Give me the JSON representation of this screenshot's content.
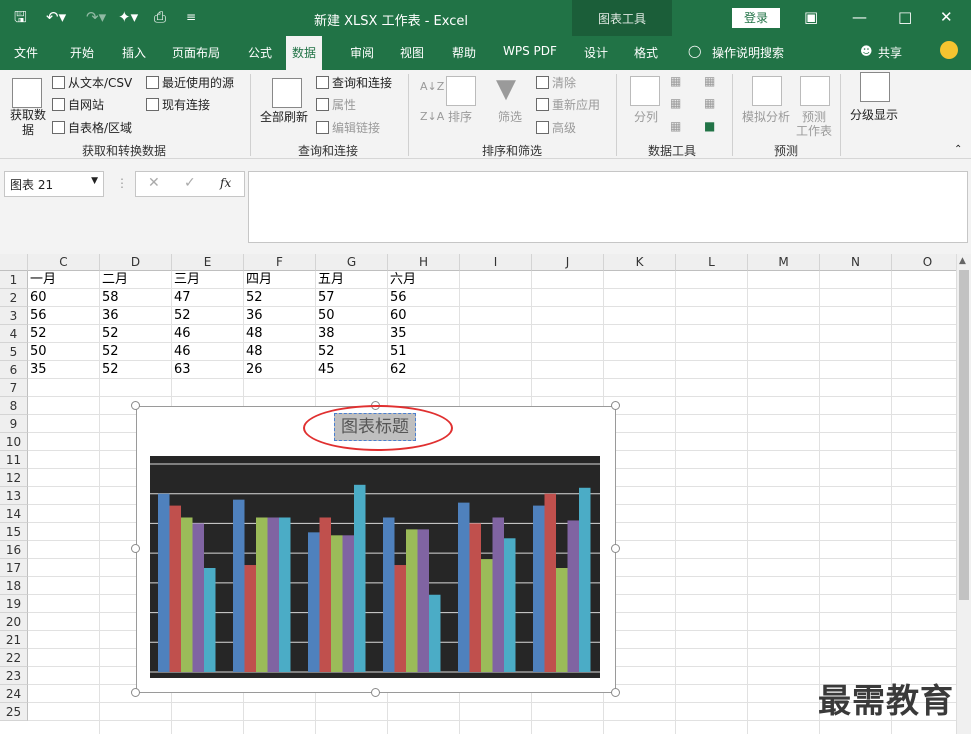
{
  "window": {
    "title": "新建 XLSX 工作表 - Excel",
    "context_group": "图表工具",
    "login": "登录"
  },
  "tabs": [
    "文件",
    "开始",
    "插入",
    "页面布局",
    "公式",
    "数据",
    "审阅",
    "视图",
    "帮助",
    "WPS PDF",
    "设计",
    "格式"
  ],
  "active_tab": "数据",
  "tell_me": "操作说明搜索",
  "share": "共享",
  "ribbon": {
    "get": {
      "big": "获取数据",
      "from_text": "从文本/CSV",
      "from_web": "自网站",
      "from_table": "自表格/区域",
      "recent": "最近使用的源",
      "existing": "现有连接",
      "label": "获取和转换数据"
    },
    "query": {
      "refresh": "全部刷新",
      "queries": "查询和连接",
      "props": "属性",
      "edit": "编辑链接",
      "label": "查询和连接"
    },
    "sort": {
      "sort": "排序",
      "filter": "筛选",
      "clear": "清除",
      "reapply": "重新应用",
      "advanced": "高级",
      "label": "排序和筛选"
    },
    "tools": {
      "split": "分列",
      "label": "数据工具"
    },
    "forecast": {
      "whatif": "模拟分析",
      "sheet": "预测",
      "sheet2": "工作表",
      "label": "预测"
    },
    "outline": {
      "label": "分级显示"
    }
  },
  "formula_bar": {
    "name_box": "图表 21",
    "fx": "fx"
  },
  "columns": [
    "C",
    "D",
    "E",
    "F",
    "G",
    "H",
    "I",
    "J",
    "K",
    "L",
    "M",
    "N",
    "O"
  ],
  "rows": [
    "1",
    "2",
    "3",
    "4",
    "5",
    "6",
    "7",
    "8",
    "9",
    "10",
    "11",
    "12",
    "13",
    "14",
    "15",
    "16",
    "17",
    "18",
    "19",
    "20",
    "21",
    "22",
    "23",
    "24",
    "25"
  ],
  "table": {
    "headers": [
      "一月",
      "二月",
      "三月",
      "四月",
      "五月",
      "六月"
    ],
    "rows": [
      [
        "60",
        "58",
        "47",
        "52",
        "57",
        "56"
      ],
      [
        "56",
        "36",
        "52",
        "36",
        "50",
        "60"
      ],
      [
        "52",
        "52",
        "46",
        "48",
        "38",
        "35"
      ],
      [
        "50",
        "52",
        "46",
        "48",
        "52",
        "51"
      ],
      [
        "35",
        "52",
        "63",
        "26",
        "45",
        "62"
      ]
    ]
  },
  "chart_data": {
    "type": "bar",
    "title": "图表标题",
    "categories": [
      "",
      "",
      "",
      "",
      "",
      ""
    ],
    "series": [
      {
        "values": [
          60,
          58,
          47,
          52,
          57,
          56
        ],
        "color": "#4f81bd"
      },
      {
        "values": [
          56,
          36,
          52,
          36,
          50,
          60
        ],
        "color": "#c0504d"
      },
      {
        "values": [
          52,
          52,
          46,
          48,
          38,
          35
        ],
        "color": "#9bbb59"
      },
      {
        "values": [
          50,
          52,
          46,
          48,
          52,
          51
        ],
        "color": "#8064a2"
      },
      {
        "values": [
          35,
          52,
          63,
          26,
          45,
          62
        ],
        "color": "#4bacc6"
      }
    ],
    "ylim": [
      0,
      70
    ],
    "grid": true,
    "background": "#262626"
  },
  "watermark": "最需教育",
  "colors": {
    "excel_green": "#217346",
    "highlight_ring": "#e03030"
  }
}
